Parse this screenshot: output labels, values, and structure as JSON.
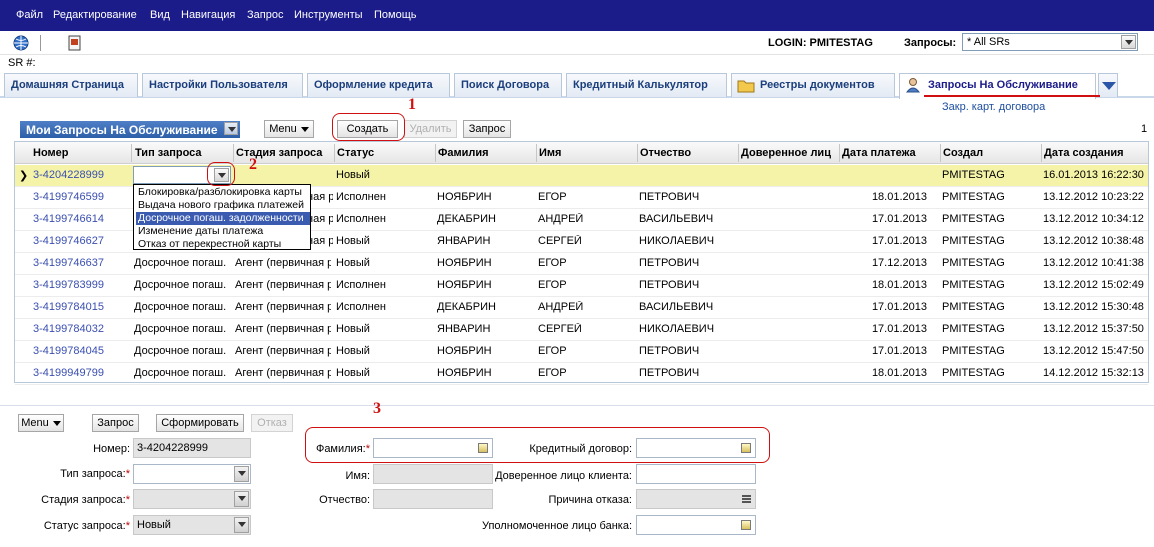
{
  "menubar": [
    "Файл",
    "Редактирование",
    "Вид",
    "Навигация",
    "Запрос",
    "Инструменты",
    "Помощь"
  ],
  "toolbar": {
    "login": "LOGIN: PMITESTAG",
    "queries_label": "Запросы:",
    "queries_value": "* All SRs"
  },
  "sr_label": "SR #:",
  "tabs": [
    "Домашняя Страница",
    "Настройки Пользователя",
    "Оформление кредита",
    "Поиск Договора",
    "Кредитный Калькулятор",
    "Реестры документов",
    "Запросы На Обслуживание"
  ],
  "sub_link": "Закр. карт. договора",
  "list": {
    "title": "Мои Запросы На Обслуживание",
    "menu": "Menu",
    "create": "Создать",
    "delete": "Удалить",
    "query": "Запрос",
    "page": "1",
    "columns": [
      "Номер",
      "Тип запроса",
      "Стадия запроса",
      "Статус",
      "Фамилия",
      "Имя",
      "Отчество",
      "Доверенное лиц",
      "Дата платежа",
      "Создал",
      "Дата создания"
    ],
    "rows": [
      [
        "3-4204228999",
        "",
        "",
        "Новый",
        "",
        "",
        "",
        "",
        "",
        "PMITESTAG",
        "16.01.2013 16:22:30"
      ],
      [
        "3-4199746599",
        "",
        "ная р",
        "Исполнен",
        "НОЯБРИН",
        "ЕГОР",
        "ПЕТРОВИЧ",
        "",
        "18.01.2013",
        "PMITESTAG",
        "13.12.2012 10:23:22"
      ],
      [
        "3-4199746614",
        "",
        "ная р",
        "Исполнен",
        "ДЕКАБРИН",
        "АНДРЕЙ",
        "ВАСИЛЬЕВИЧ",
        "",
        "17.01.2013",
        "PMITESTAG",
        "13.12.2012 10:34:12"
      ],
      [
        "3-4199746627",
        "",
        "ная р",
        "Новый",
        "ЯНВАРИН",
        "СЕРГЕЙ",
        "НИКОЛАЕВИЧ",
        "",
        "17.01.2013",
        "PMITESTAG",
        "13.12.2012 10:38:48"
      ],
      [
        "3-4199746637",
        "Досрочное погаш.",
        "Агент (первичная р",
        "Новый",
        "НОЯБРИН",
        "ЕГОР",
        "ПЕТРОВИЧ",
        "",
        "17.12.2013",
        "PMITESTAG",
        "13.12.2012 10:41:38"
      ],
      [
        "3-4199783999",
        "Досрочное погаш.",
        "Агент (первичная р",
        "Исполнен",
        "НОЯБРИН",
        "ЕГОР",
        "ПЕТРОВИЧ",
        "",
        "18.01.2013",
        "PMITESTAG",
        "13.12.2012 15:02:49"
      ],
      [
        "3-4199784015",
        "Досрочное погаш.",
        "Агент (первичная р",
        "Исполнен",
        "ДЕКАБРИН",
        "АНДРЕЙ",
        "ВАСИЛЬЕВИЧ",
        "",
        "17.01.2013",
        "PMITESTAG",
        "13.12.2012 15:30:48"
      ],
      [
        "3-4199784032",
        "Досрочное погаш.",
        "Агент (первичная р",
        "Новый",
        "ЯНВАРИН",
        "СЕРГЕЙ",
        "НИКОЛАЕВИЧ",
        "",
        "17.01.2013",
        "PMITESTAG",
        "13.12.2012 15:37:50"
      ],
      [
        "3-4199784045",
        "Досрочное погаш.",
        "Агент (первичная р",
        "Новый",
        "НОЯБРИН",
        "ЕГОР",
        "ПЕТРОВИЧ",
        "",
        "17.01.2013",
        "PMITESTAG",
        "13.12.2012 15:47:50"
      ],
      [
        "3-4199949799",
        "Досрочное погаш.",
        "Агент (первичная р",
        "Новый",
        "НОЯБРИН",
        "ЕГОР",
        "ПЕТРОВИЧ",
        "",
        "18.01.2013",
        "PMITESTAG",
        "14.12.2012 15:32:13"
      ]
    ],
    "dropdown_options": [
      "Блокировка/разблокировка карты",
      "Выдача нового графика платежей",
      "Досрочное погаш. задолженности",
      "Изменение даты платежа",
      "Отказ от перекрестной карты"
    ]
  },
  "annotations": [
    "1",
    "2",
    "3"
  ],
  "form": {
    "menu": "Menu",
    "query": "Запрос",
    "generate": "Сформировать",
    "reject": "Отказ",
    "number_label": "Номер:",
    "number_value": "3-4204228999",
    "type_label": "Тип запроса:",
    "stage_label": "Стадия запроса:",
    "status_label": "Статус запроса:",
    "status_value": "Новый",
    "lastname_label": "Фамилия:",
    "firstname_label": "Имя:",
    "patronymic_label": "Отчество:",
    "credit_label": "Кредитный договор:",
    "trustee_label": "Доверенное лицо клиента:",
    "reject_reason_label": "Причина отказа:",
    "bank_rep_label": "Уполномоченное лицо банка:",
    "required_mark": "*"
  }
}
